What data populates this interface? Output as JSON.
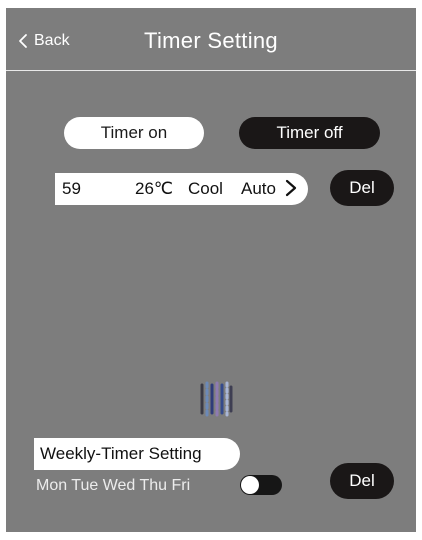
{
  "header": {
    "back_label": "Back",
    "title": "Timer Setting",
    "back_icon": "chevron-left-icon"
  },
  "tabs": [
    {
      "label": "Timer on",
      "selected": false
    },
    {
      "label": "Timer off",
      "selected": true
    }
  ],
  "timer_entry": {
    "time": "59",
    "temperature": "26℃",
    "mode": "Cool",
    "fan": "Auto",
    "chevron_icon": "chevron-right-icon",
    "delete_label": "Del"
  },
  "loading_icon": "spinner-icon",
  "weekly_timer": {
    "title": "Weekly-Timer Setting",
    "days": "Mon Tue Wed Thu Fri",
    "enabled": false,
    "delete_label": "Del"
  },
  "colors": {
    "background": "#7d7d7d",
    "dark_pill": "#1a1717",
    "light_pill": "#ffffff",
    "text_light": "#ffffff"
  }
}
